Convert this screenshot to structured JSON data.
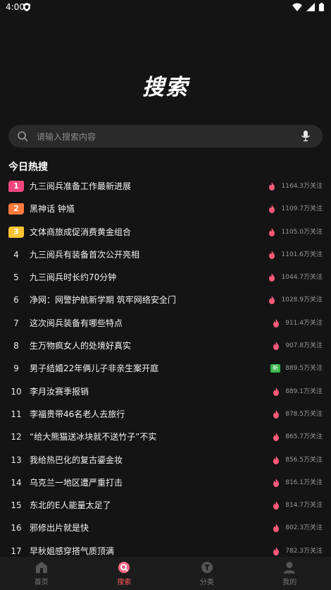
{
  "status_bar": {
    "time": "4:00"
  },
  "hero": {
    "title": "搜索"
  },
  "search": {
    "placeholder": "请输入搜索内容"
  },
  "section": {
    "title": "今日热搜"
  },
  "colors": {
    "rank1": "#f0467c",
    "rank2": "#ff7a3c",
    "rank3": "#ffc331",
    "flame": "#ff5a7a",
    "new_tag": "#39b54a",
    "active_nav": "#ff5a5a"
  },
  "hot_list": [
    {
      "rank": "1",
      "title": "九三阅兵准备工作最新进展",
      "count": "1164.3万关注",
      "tag": "flame-icon"
    },
    {
      "rank": "2",
      "title": "黑神话 钟馗",
      "count": "1109.7万关注",
      "tag": "flame-icon"
    },
    {
      "rank": "3",
      "title": "文体商旅成促消费黄金组合",
      "count": "1105.0万关注",
      "tag": "flame-icon"
    },
    {
      "rank": "4",
      "title": "九三阅兵有装备首次公开亮相",
      "count": "1101.6万关注",
      "tag": "flame-icon"
    },
    {
      "rank": "5",
      "title": "九三阅兵时长约70分钟",
      "count": "1044.7万关注",
      "tag": "flame-icon"
    },
    {
      "rank": "6",
      "title": "净网：网警护航新学期 筑牢网络安全门",
      "count": "1028.9万关注",
      "tag": "flame-icon"
    },
    {
      "rank": "7",
      "title": "这次阅兵装备有哪些特点",
      "count": "911.4万关注",
      "tag": "flame-icon"
    },
    {
      "rank": "8",
      "title": "生万物疯女人的处境好真实",
      "count": "907.8万关注",
      "tag": "flame-icon"
    },
    {
      "rank": "9",
      "title": "男子结婚22年俩儿子非亲生案开庭",
      "count": "889.5万关注",
      "tag": "new-icon",
      "tag_text": "新"
    },
    {
      "rank": "10",
      "title": "李月汝赛季报销",
      "count": "889.1万关注",
      "tag": "flame-icon"
    },
    {
      "rank": "11",
      "title": "李福贵带46名老人去旅行",
      "count": "878.5万关注",
      "tag": "flame-icon"
    },
    {
      "rank": "12",
      "title": "“给大熊猫送冰块就不送竹子”不实",
      "count": "865.7万关注",
      "tag": "flame-icon"
    },
    {
      "rank": "13",
      "title": "我给热巴化的复古鎏金妆",
      "count": "856.5万关注",
      "tag": "flame-icon"
    },
    {
      "rank": "14",
      "title": "乌克兰一地区遭严重打击",
      "count": "816.1万关注",
      "tag": "flame-icon"
    },
    {
      "rank": "15",
      "title": "东北的E人能量太足了",
      "count": "814.7万关注",
      "tag": "flame-icon"
    },
    {
      "rank": "16",
      "title": "邪修出片就是快",
      "count": "802.3万关注",
      "tag": "flame-icon"
    },
    {
      "rank": "17",
      "title": "早秋姐感穿搭气质顶满",
      "count": "782.3万关注",
      "tag": "flame-icon"
    }
  ],
  "nav": [
    {
      "label": "首页",
      "icon": "home-icon"
    },
    {
      "label": "搜索",
      "icon": "search-icon",
      "active": true
    },
    {
      "label": "分类",
      "icon": "category-icon"
    },
    {
      "label": "我的",
      "icon": "profile-icon"
    }
  ]
}
